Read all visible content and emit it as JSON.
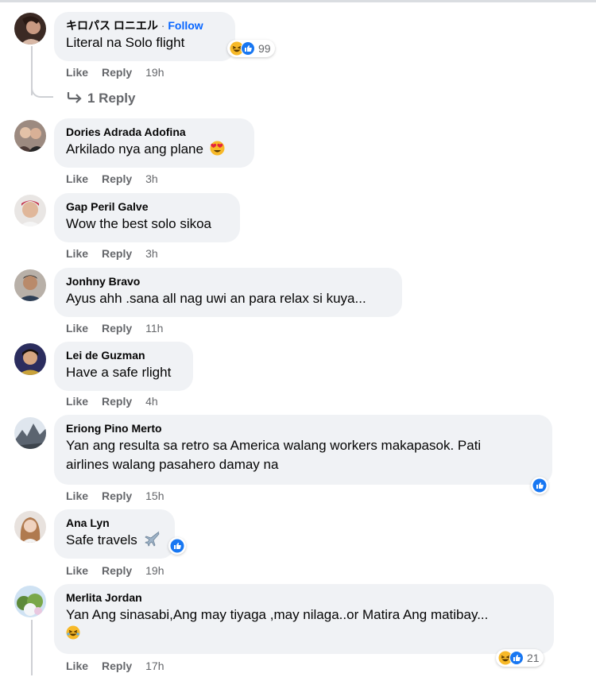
{
  "comments": [
    {
      "name": "キロパス ロニエル",
      "follow": "Follow",
      "separator": "·",
      "text": "Literal na Solo flight",
      "like": "Like",
      "reply": "Reply",
      "time": "19h",
      "reaction_count": "99",
      "replies": "1 Reply"
    },
    {
      "name": "Dories Adrada Adofina",
      "text": "Arkilado nya ang plane",
      "like": "Like",
      "reply": "Reply",
      "time": "3h"
    },
    {
      "name": "Gap Peril Galve",
      "text": "Wow the best solo sikoa",
      "like": "Like",
      "reply": "Reply",
      "time": "3h"
    },
    {
      "name": "Jonhny Bravo",
      "text": "Ayus ahh .sana all nag uwi an para relax si kuya...",
      "like": "Like",
      "reply": "Reply",
      "time": "11h"
    },
    {
      "name": "Lei de Guzman",
      "text": "Have a safe rlight",
      "like": "Like",
      "reply": "Reply",
      "time": "4h"
    },
    {
      "name": "Eriong Pino Merto",
      "text_line1": "Yan ang resulta sa retro sa America walang workers makapasok. Pati",
      "text_line2": "airlines walang pasahero damay na",
      "like": "Like",
      "reply": "Reply",
      "time": "15h"
    },
    {
      "name": "Ana Lyn",
      "text": "Safe travels",
      "like": "Like",
      "reply": "Reply",
      "time": "19h"
    },
    {
      "name": "Merlita Jordan",
      "text": "Yan Ang sinasabi,Ang may tiyaga ,may nilaga..or Matira Ang matibay...",
      "like": "Like",
      "reply": "Reply",
      "time": "17h",
      "reaction_count": "21"
    }
  ],
  "icons": {
    "like_reaction": "like-reaction-icon",
    "haha_reaction": "haha-reaction-icon",
    "heart_eyes_emoji": "heart-eyes-emoji-icon",
    "airplane_emoji": "airplane-emoji-icon",
    "reply_arrow": "reply-arrow-icon"
  },
  "colors": {
    "like_blue": "#1877f2",
    "haha_yellow": "#f7b928",
    "follow_blue": "#0866ff",
    "meta_gray": "#65676b",
    "bubble_gray": "#f0f2f5"
  }
}
